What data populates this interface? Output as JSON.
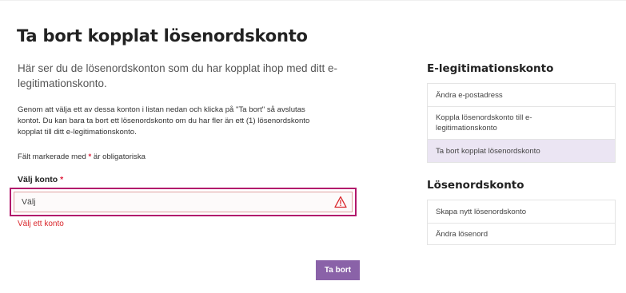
{
  "page": {
    "title": "Ta bort kopplat lösenordskonto"
  },
  "main": {
    "intro": "Här ser du de lösenordskonton som du har kopplat ihop med ditt e-legitimationskonto.",
    "body_line_1": "Genom att välja ett av dessa konton i listan nedan och klicka på \"Ta bort\" så avslutas",
    "body_line_2": "kontot. Du kan bara ta bort ett lösenordskonto om du har fler än ett (1) lösenordskonto",
    "body_line_3": "kopplat till ditt e-legitimationskonto.",
    "required_prefix": "Fält markerade med",
    "required_star": "*",
    "required_suffix": "är obligatoriska",
    "field_label": "Välj konto",
    "field_star": "*",
    "select_value": "Välj",
    "error": "Välj ett konto",
    "delete_label": "Ta bort"
  },
  "sidebar": {
    "section1_title": "E-legitimationskonto",
    "section1_items": [
      {
        "label": "Ändra e-postadress"
      },
      {
        "label": "Koppla lösenordskonto till e-legitimationskonto"
      },
      {
        "label": "Ta bort kopplat lösenordskonto",
        "active": true
      }
    ],
    "section2_title": "Lösenordskonto",
    "section2_items": [
      {
        "label": "Skapa nytt lösenordskonto"
      },
      {
        "label": "Ändra lösenord"
      }
    ]
  },
  "colors": {
    "accent_purple": "#8a62a8",
    "focus_border": "#b2186c",
    "error_red": "#d9252a",
    "active_item_bg": "#ebe5f3"
  },
  "icons": {
    "warning": "warning-triangle-icon"
  }
}
